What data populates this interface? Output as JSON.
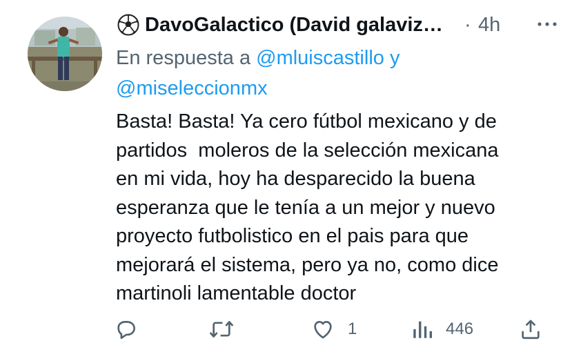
{
  "tweet": {
    "display_name": "DavoGalactico (David galaviz…",
    "separator": "·",
    "time": "4h",
    "reply_prefix": "En respuesta a",
    "mention_1": "@mluiscastillo",
    "reply_joiner": "y",
    "mention_2": "@miseleccionmx",
    "body": "Basta! Basta! Ya cero fútbol mexicano y de\npartidos  moleros de la selección mexicana\nen mi vida, hoy ha desparecido la buena\nesperanza que le tenía a un mejor y nuevo\nproyecto futbolistico en el pais para que\nmejorará el sistema, pero ya no, como dice\nmartinoli lamentable doctor"
  },
  "actions": {
    "reply_count": "",
    "retweet_count": "",
    "like_count": "1",
    "views_count": "446"
  },
  "colors": {
    "text": "#0f1419",
    "secondary": "#536471",
    "accent": "#1d9bf0"
  },
  "icons": {
    "name_prefix": "soccer-ball-icon",
    "more": "more-icon",
    "reply": "reply-icon",
    "retweet": "retweet-icon",
    "like": "heart-icon",
    "views": "views-icon",
    "share": "share-icon"
  }
}
